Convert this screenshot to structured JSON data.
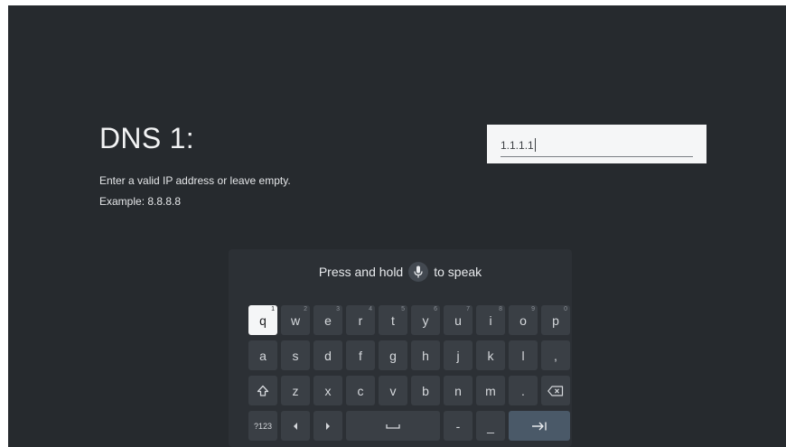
{
  "dialog": {
    "title": "DNS 1:",
    "description": "Enter a valid IP address or leave empty.",
    "example": "Example: 8.8.8.8"
  },
  "input": {
    "value": "1.1.1.1"
  },
  "keyboard": {
    "hint_before": "Press and hold",
    "hint_after": "to speak",
    "row1": [
      {
        "label": "q",
        "num": "1"
      },
      {
        "label": "w",
        "num": "2"
      },
      {
        "label": "e",
        "num": "3"
      },
      {
        "label": "r",
        "num": "4"
      },
      {
        "label": "t",
        "num": "5"
      },
      {
        "label": "y",
        "num": "6"
      },
      {
        "label": "u",
        "num": "7"
      },
      {
        "label": "i",
        "num": "8"
      },
      {
        "label": "o",
        "num": "9"
      },
      {
        "label": "p",
        "num": "0"
      }
    ],
    "row2": [
      "a",
      "s",
      "d",
      "f",
      "g",
      "h",
      "j",
      "k",
      "l",
      ","
    ],
    "row3": [
      "z",
      "x",
      "c",
      "v",
      "b",
      "n",
      "m",
      "."
    ],
    "symbols_label": "?123",
    "dash": "-",
    "underscore": "_",
    "selected_key": "q"
  }
}
